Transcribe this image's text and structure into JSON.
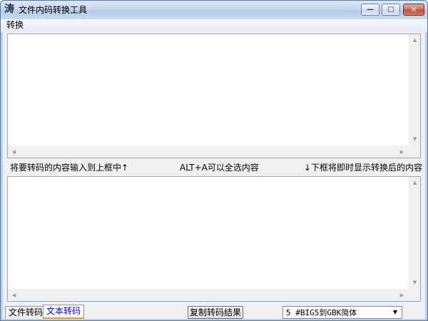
{
  "window": {
    "title": "文件内码转换工具",
    "app_icon_glyph": "涛"
  },
  "menu": {
    "items": [
      "转换"
    ]
  },
  "input_box": {
    "value": ""
  },
  "output_box": {
    "value": ""
  },
  "hints": {
    "left": "将要转码的内容输入到上框中↑",
    "middle": "ALT+A可以全选内容",
    "right": "↓下框将即时显示转换后的内容"
  },
  "tabs": [
    {
      "label": "文件转码",
      "selected": false
    },
    {
      "label": "文本转码",
      "selected": true
    }
  ],
  "copy_button": {
    "label": "复制转码结果"
  },
  "mode_select": {
    "selected": "5 #BIG5到GBK简体"
  },
  "icons": {
    "minimize": "minimize-icon",
    "maximize": "maximize-icon",
    "close": "close-icon",
    "dropdown": "chevron-down-icon"
  },
  "colors": {
    "titlebar": "#c2d7ef",
    "close_button": "#c04b31",
    "selected_tab_text": "#0000ff"
  }
}
